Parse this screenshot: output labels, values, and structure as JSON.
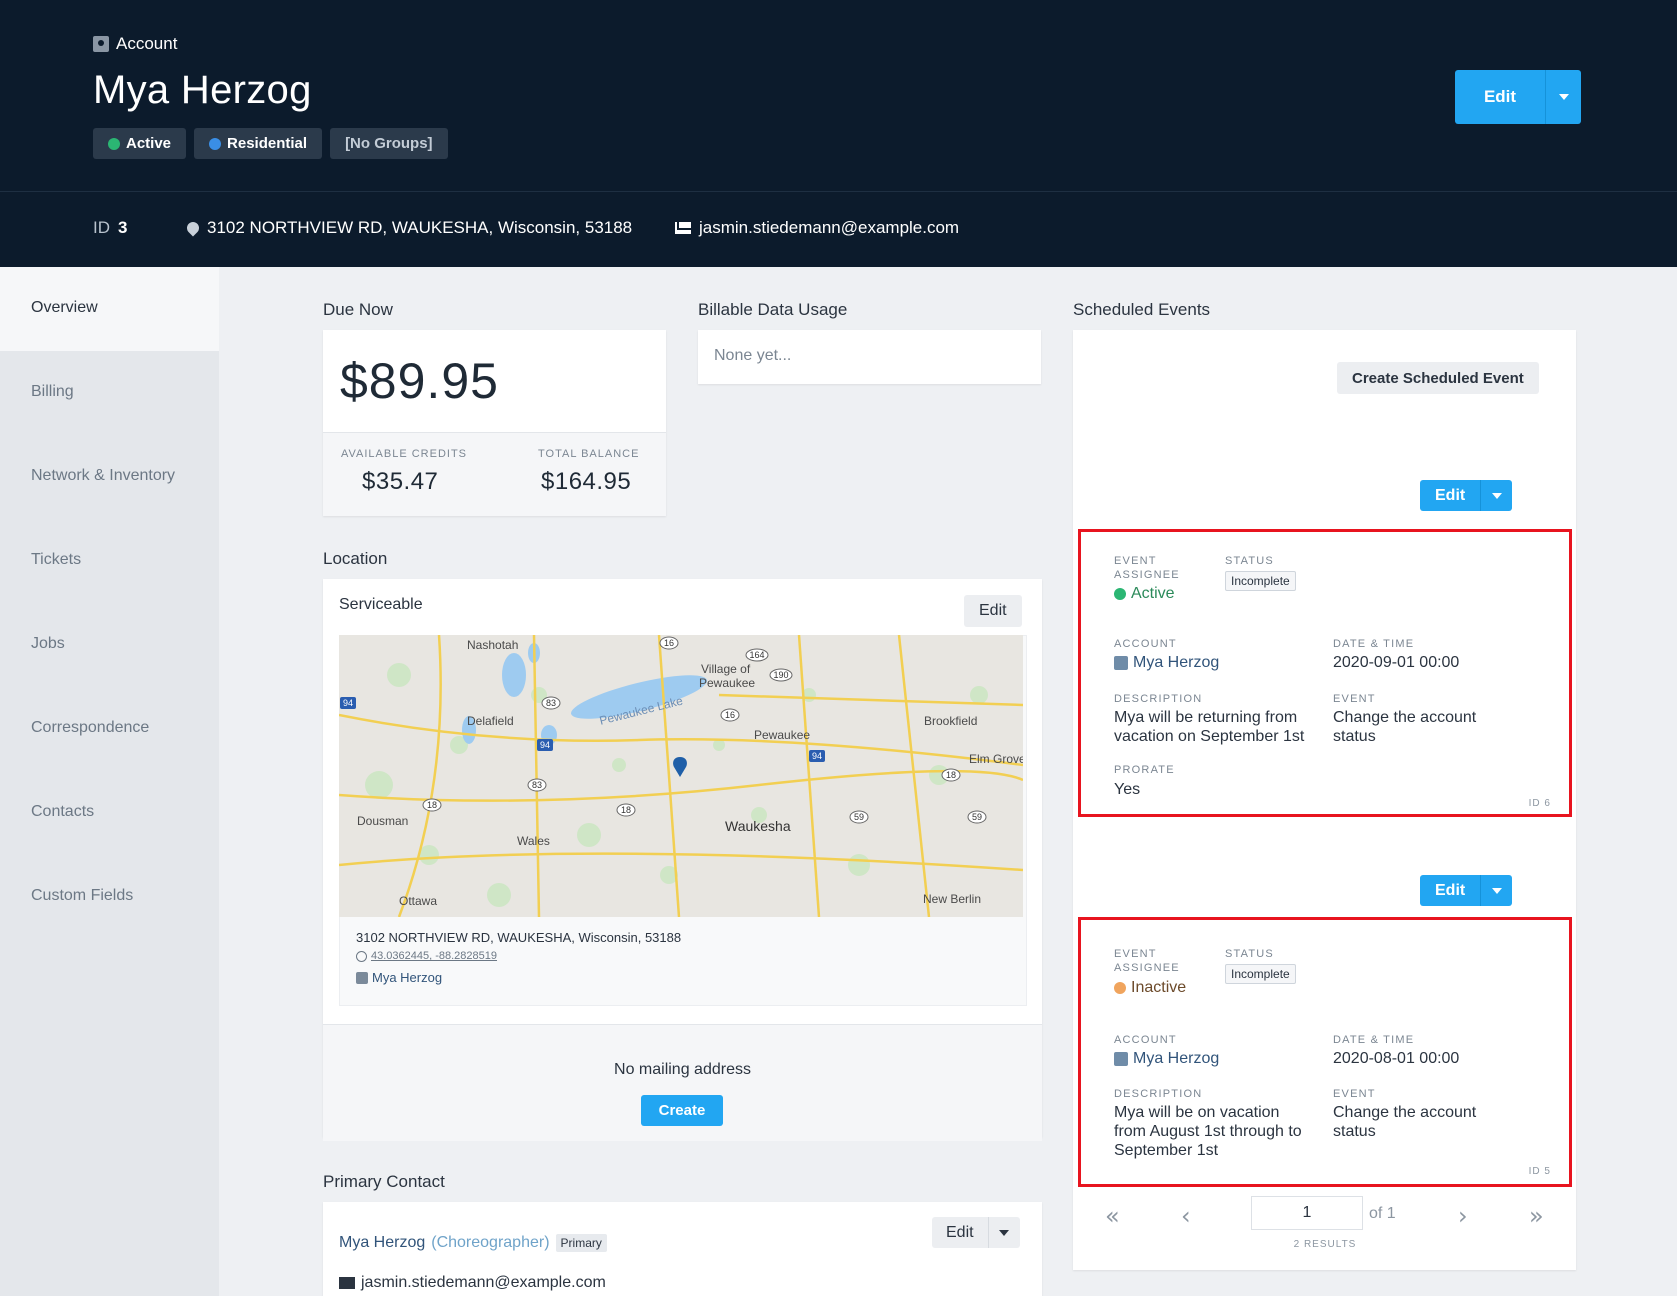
{
  "header": {
    "crumb": "Account",
    "title": "Mya Herzog",
    "badges": {
      "status": "Active",
      "type": "Residential",
      "groups": "[No Groups]"
    },
    "edit_label": "Edit",
    "id_label": "ID",
    "id_value": "3",
    "address": "3102 NORTHVIEW RD, WAUKESHA, Wisconsin, 53188",
    "email": "jasmin.stiedemann@example.com"
  },
  "sidebar": {
    "items": [
      {
        "label": "Overview"
      },
      {
        "label": "Billing"
      },
      {
        "label": "Network & Inventory"
      },
      {
        "label": "Tickets"
      },
      {
        "label": "Jobs"
      },
      {
        "label": "Correspondence"
      },
      {
        "label": "Contacts"
      },
      {
        "label": "Custom Fields"
      }
    ]
  },
  "due_now": {
    "title": "Due Now",
    "amount": "$89.95",
    "credits_label": "AVAILABLE CREDITS",
    "credits": "$35.47",
    "balance_label": "TOTAL BALANCE",
    "balance": "$164.95"
  },
  "data_usage": {
    "title": "Billable Data Usage",
    "empty": "None yet..."
  },
  "location": {
    "title": "Location",
    "status": "Serviceable",
    "edit_label": "Edit",
    "address": "3102 NORTHVIEW RD, WAUKESHA, Wisconsin, 53188",
    "coords": "43.0362445, -88.2828519",
    "account": "Mya Herzog",
    "mailing_empty": "No mailing address",
    "create_label": "Create",
    "map_labels": {
      "nashotah": "Nashotah",
      "village": "Village of",
      "pewaukee_v": "Pewaukee",
      "lake": "Pewaukee Lake",
      "delafield": "Delafield",
      "pewaukee": "Pewaukee",
      "brookfield": "Brookfield",
      "elm": "Elm Grove",
      "dousman": "Dousman",
      "wales": "Wales",
      "waukesha": "Waukesha",
      "ottawa": "Ottawa",
      "newberlin": "New Berlin",
      "r16a": "16",
      "r164": "164",
      "r190": "190",
      "r94a": "94",
      "r83a": "83",
      "r94b": "94",
      "r16b": "16",
      "r94c": "94",
      "r83b": "83",
      "r18a": "18",
      "r18b": "18",
      "r18c": "18",
      "r59a": "59",
      "r59b": "59"
    }
  },
  "primary_contact": {
    "title": "Primary Contact",
    "name": "Mya Herzog",
    "role": "(Choreographer)",
    "tag": "Primary",
    "edit_label": "Edit",
    "email": "jasmin.stiedemann@example.com"
  },
  "scheduled_events": {
    "title": "Scheduled Events",
    "create_label": "Create Scheduled Event",
    "edit_label": "Edit",
    "labels": {
      "event": "EVENT",
      "assignee": "ASSIGNEE",
      "status": "STATUS",
      "account": "ACCOUNT",
      "datetime": "DATE & TIME",
      "description": "DESCRIPTION",
      "event_type": "EVENT",
      "prorate": "PRORATE"
    },
    "events": [
      {
        "assignee": "Active",
        "status": "Incomplete",
        "account": "Mya Herzog",
        "datetime": "2020-09-01 00:00",
        "description_lines": [
          "Mya will be returning from",
          "vacation on September 1st"
        ],
        "event_lines": [
          "Change the account",
          "status"
        ],
        "prorate": "Yes",
        "id": "ID 6"
      },
      {
        "assignee": "Inactive",
        "status": "Incomplete",
        "account": "Mya Herzog",
        "datetime": "2020-08-01 00:00",
        "description_lines": [
          "Mya will be on vacation",
          "from August 1st through to",
          "September 1st"
        ],
        "event_lines": [
          "Change the account",
          "status"
        ],
        "id": "ID 5"
      }
    ],
    "pager": {
      "page": "1",
      "of": "of 1",
      "results": "2 RESULTS"
    }
  },
  "colors": {
    "header_bg": "#0c1b2c",
    "accent": "#22a6f2",
    "highlight": "#e8141f",
    "active": "#2bb673",
    "inactive": "#f0a45d"
  }
}
